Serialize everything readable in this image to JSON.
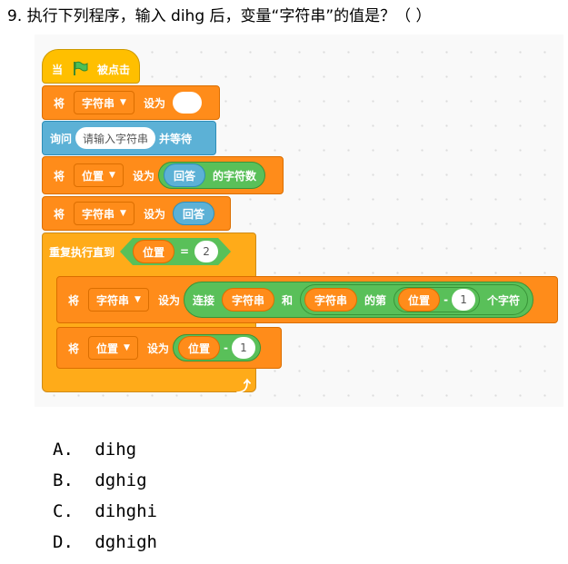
{
  "question": "9. 执行下列程序，输入 dihg 后，变量“字符串”的值是？（  ）",
  "blocks": {
    "hat": {
      "when": "当",
      "clicked": "被点击",
      "flag_icon": "green-flag-icon"
    },
    "set1": {
      "set": "将",
      "var": "字符串",
      "to": "设为",
      "value": ""
    },
    "ask": {
      "ask": "询问",
      "prompt": "请输入字符串",
      "wait": "并等待"
    },
    "set2": {
      "set": "将",
      "var": "位置",
      "to": "设为",
      "answer": "回答",
      "length_of": "的字符数"
    },
    "set3": {
      "set": "将",
      "var": "字符串",
      "to": "设为",
      "answer": "回答"
    },
    "repeat": {
      "label": "重复执行直到",
      "var": "位置",
      "eq": "=",
      "value": "2"
    },
    "set4": {
      "set": "将",
      "var": "字符串",
      "to": "设为",
      "join": "连接",
      "a": "字符串",
      "and": "和",
      "b": "字符串",
      "of_nth": "的第",
      "pos": "位置",
      "minus": "-",
      "one": "1",
      "char": "个字符"
    },
    "set5": {
      "set": "将",
      "var": "位置",
      "to": "设为",
      "pos": "位置",
      "minus": "-",
      "one": "1"
    }
  },
  "options": [
    {
      "letter": "A.",
      "text": "dihg"
    },
    {
      "letter": "B.",
      "text": "dghig"
    },
    {
      "letter": "C.",
      "text": "dihghi"
    },
    {
      "letter": "D.",
      "text": "dghigh"
    }
  ]
}
